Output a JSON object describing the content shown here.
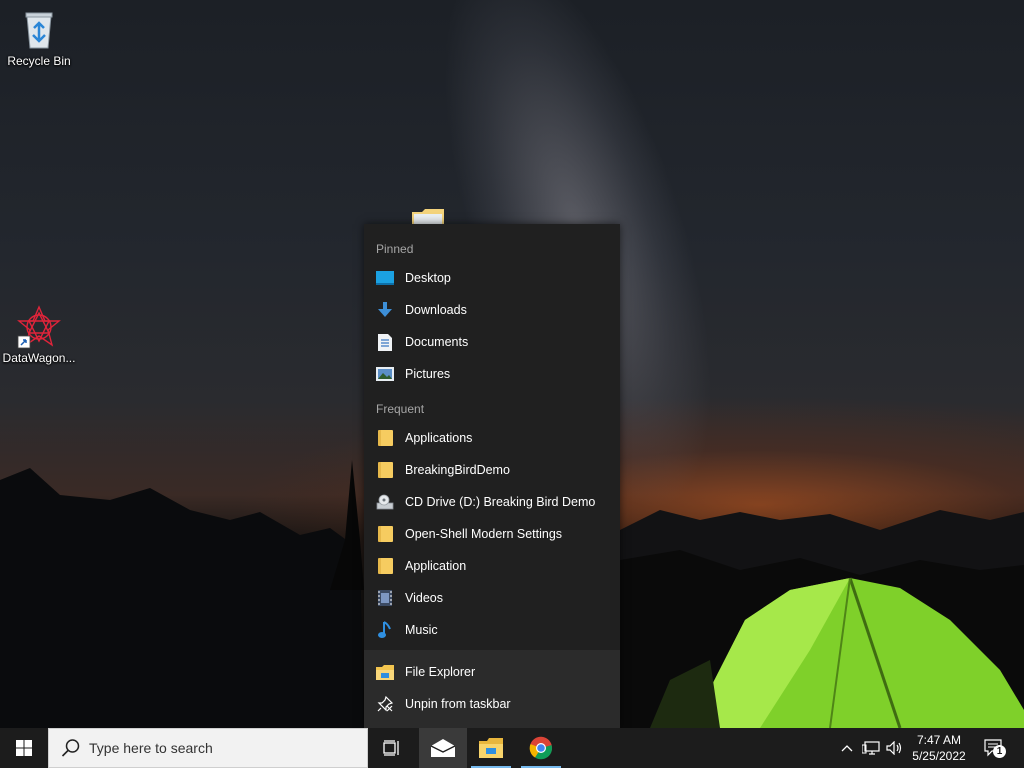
{
  "desktop": {
    "icons": [
      {
        "label": "Recycle Bin",
        "icon": "recycle-bin-icon"
      },
      {
        "label": "DataWagon...",
        "icon": "datawagon-icon"
      }
    ]
  },
  "jumplist": {
    "pinned_header": "Pinned",
    "pinned": [
      {
        "label": "Desktop",
        "icon": "desktop-icon"
      },
      {
        "label": "Downloads",
        "icon": "download-icon"
      },
      {
        "label": "Documents",
        "icon": "document-icon"
      },
      {
        "label": "Pictures",
        "icon": "pictures-icon"
      }
    ],
    "frequent_header": "Frequent",
    "frequent": [
      {
        "label": "Applications",
        "icon": "folder-icon"
      },
      {
        "label": "BreakingBirdDemo",
        "icon": "folder-icon"
      },
      {
        "label": "CD Drive (D:) Breaking Bird Demo",
        "icon": "cd-drive-icon"
      },
      {
        "label": "Open-Shell Modern Settings",
        "icon": "folder-icon"
      },
      {
        "label": "Application",
        "icon": "folder-icon"
      },
      {
        "label": "Videos",
        "icon": "videos-icon"
      },
      {
        "label": "Music",
        "icon": "music-icon"
      }
    ],
    "actions": [
      {
        "label": "File Explorer",
        "icon": "file-explorer-icon"
      },
      {
        "label": "Unpin from taskbar",
        "icon": "unpin-icon"
      }
    ]
  },
  "taskbar": {
    "search_placeholder": "Type here to search",
    "apps": [
      {
        "name": "Task View",
        "icon": "task-view-icon"
      },
      {
        "name": "Mail",
        "icon": "mail-icon"
      },
      {
        "name": "File Explorer",
        "icon": "file-explorer-icon"
      },
      {
        "name": "Google Chrome",
        "icon": "chrome-icon"
      }
    ],
    "tray": {
      "time": "7:47 AM",
      "date": "5/25/2022",
      "notification_count": "1"
    }
  },
  "colors": {
    "jumplist_bg": "#202020",
    "taskbar_bg": "#1c1c1c",
    "accent_blue": "#1ba1e2",
    "folder_yellow": "#f6cc60"
  }
}
